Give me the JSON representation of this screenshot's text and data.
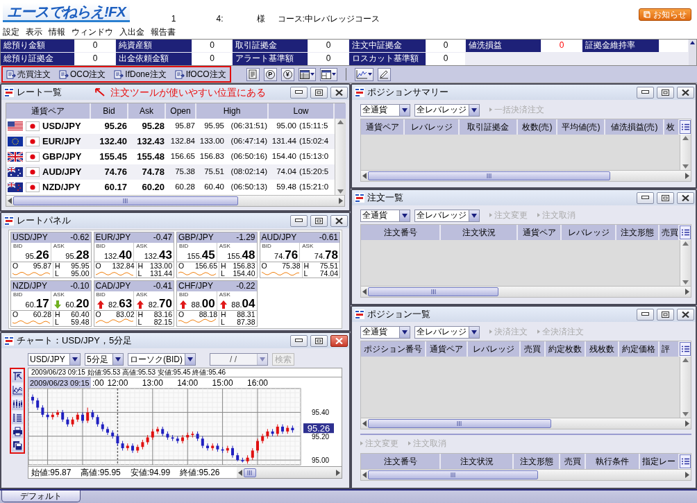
{
  "header": {
    "logo": "エースでねらえ!FX",
    "user_info": [
      "1",
      "4:",
      "様",
      "コース:中レバレッジコース"
    ],
    "notice_button": "お知らせ"
  },
  "menu": [
    "設定",
    "表示",
    "情報",
    "ウィンドウ",
    "入出金",
    "報告書"
  ],
  "account": [
    [
      {
        "label": "総預り金額",
        "value": "0",
        "alert": false
      },
      {
        "label": "純資産額",
        "value": "0",
        "alert": false
      },
      {
        "label": "取引証拠金",
        "value": "0",
        "alert": false
      },
      {
        "label": "注文中証拠金",
        "value": "0",
        "alert": false
      },
      {
        "label": "値洗損益",
        "value": "0",
        "alert": true
      },
      {
        "label": "証拠金維持率"
      }
    ],
    [
      {
        "label": "総預り証拠金",
        "value": "0",
        "alert": false
      },
      {
        "label": "出金依頼金額",
        "value": "0",
        "alert": false
      },
      {
        "label": "アラート基準額",
        "value": "0",
        "alert": false
      },
      {
        "label": "ロスカット基準額",
        "value": "0",
        "alert": false
      }
    ]
  ],
  "toolbar": {
    "order_buttons": [
      "売買注文",
      "OCO注文",
      "IfDone注文",
      "IfOCO注文"
    ],
    "tools": [
      {
        "kind": "document",
        "dropdown": false
      },
      {
        "kind": "coin",
        "glyph": "P",
        "dropdown": false
      },
      {
        "kind": "coin",
        "glyph": "¥",
        "dropdown": false
      },
      {
        "kind": "table",
        "dropdown": true
      },
      {
        "kind": "layout",
        "dropdown": true
      },
      {
        "kind": "separator",
        "dropdown": false
      },
      {
        "kind": "chart",
        "dropdown": true
      },
      {
        "kind": "pen",
        "dropdown": false
      }
    ]
  },
  "callout": "注文ツールが使いやすい位置にある",
  "rate_list": {
    "title": "レート一覧",
    "active": false,
    "columns": [
      "通貨ペア",
      "Bid",
      "Ask",
      "Open",
      "High",
      "Low"
    ],
    "rows": [
      {
        "kind": "us",
        "pair": "USD/JPY",
        "bid": "95.26",
        "ask": "95.28",
        "open": "95.87",
        "high": "95.95",
        "high_time": "(06:31:51)",
        "low": "95.00",
        "low_time": "(15:11:5"
      },
      {
        "kind": "eu",
        "pair": "EUR/JPY",
        "bid": "132.40",
        "ask": "132.43",
        "open": "132.84",
        "high": "133.00",
        "high_time": "(06:47:14)",
        "low": "131.44",
        "low_time": "(15:02:4"
      },
      {
        "kind": "gb",
        "pair": "GBP/JPY",
        "bid": "155.45",
        "ask": "155.48",
        "open": "156.65",
        "high": "156.83",
        "high_time": "(06:50:16)",
        "low": "154.40",
        "low_time": "(15:13:0"
      },
      {
        "kind": "au",
        "pair": "AUD/JPY",
        "bid": "74.76",
        "ask": "74.78",
        "open": "75.38",
        "high": "75.51",
        "high_time": "(08:02:14)",
        "low": "74.04",
        "low_time": "(15:20:5"
      },
      {
        "kind": "nz",
        "pair": "NZD/JPY",
        "bid": "60.17",
        "ask": "60.20",
        "open": "60.28",
        "high": "60.40",
        "high_time": "(06:50:13)",
        "low": "59.48",
        "low_time": "(15:21:0"
      }
    ]
  },
  "rate_panel": {
    "title": "レートパネル",
    "active": false,
    "tiles": [
      {
        "pair": "USD/JPY",
        "change": "-0.62",
        "bid_label": "BID",
        "bid_major": "95.",
        "bid_minor": "26",
        "bid_up": false,
        "bid_down": false,
        "ask_label": "ASK",
        "ask_major": "95.",
        "ask_minor": "28",
        "ask_up": false,
        "ask_down": false,
        "open_label": "O",
        "open": "95.87",
        "high_label": "H",
        "high": "95.95",
        "low_label": "L",
        "low": "95.00"
      },
      {
        "pair": "EUR/JPY",
        "change": "-0.47",
        "bid_label": "BID",
        "bid_major": "132.",
        "bid_minor": "40",
        "bid_up": false,
        "bid_down": false,
        "ask_label": "ASK",
        "ask_major": "132.",
        "ask_minor": "43",
        "ask_up": false,
        "ask_down": false,
        "open_label": "O",
        "open": "132.84",
        "high_label": "H",
        "high": "133.00",
        "low_label": "L",
        "low": "131.44"
      },
      {
        "pair": "GBP/JPY",
        "change": "-1.29",
        "bid_label": "BID",
        "bid_major": "155.",
        "bid_minor": "45",
        "bid_up": false,
        "bid_down": false,
        "ask_label": "ASK",
        "ask_major": "155.",
        "ask_minor": "48",
        "ask_up": false,
        "ask_down": false,
        "open_label": "O",
        "open": "156.65",
        "high_label": "H",
        "high": "156.83",
        "low_label": "L",
        "low": "154.40"
      },
      {
        "pair": "AUD/JPY",
        "change": "-0.61",
        "bid_label": "BID",
        "bid_major": "74.",
        "bid_minor": "76",
        "bid_up": false,
        "bid_down": false,
        "ask_label": "ASK",
        "ask_major": "74.",
        "ask_minor": "78",
        "ask_up": false,
        "ask_down": false,
        "open_label": "O",
        "open": "75.38",
        "high_label": "H",
        "high": "75.51",
        "low_label": "L",
        "low": "74.04"
      },
      {
        "pair": "NZD/JPY",
        "change": "-0.10",
        "bid_label": "BID",
        "bid_major": "60.",
        "bid_minor": "17",
        "bid_up": false,
        "bid_down": false,
        "ask_label": "ASK",
        "ask_major": "60.",
        "ask_minor": "20",
        "ask_up": false,
        "ask_down": true,
        "open_label": "O",
        "open": "60.28",
        "high_label": "H",
        "high": "60.40",
        "low_label": "L",
        "low": "59.48"
      },
      {
        "pair": "CAD/JPY",
        "change": "-0.41",
        "bid_label": "BID",
        "bid_major": "82.",
        "bid_minor": "63",
        "bid_up": true,
        "bid_down": false,
        "ask_label": "ASK",
        "ask_major": "82.",
        "ask_minor": "70",
        "ask_up": true,
        "ask_down": false,
        "open_label": "O",
        "open": "83.02",
        "high_label": "H",
        "high": "83.16",
        "low_label": "L",
        "low": "82.15"
      },
      {
        "pair": "CHF/JPY",
        "change": "-0.22",
        "bid_label": "BID",
        "bid_major": "88.",
        "bid_minor": "00",
        "bid_up": true,
        "bid_down": false,
        "ask_label": "ASK",
        "ask_major": "88.",
        "ask_minor": "04",
        "ask_up": true,
        "ask_down": false,
        "open_label": "O",
        "open": "88.18",
        "high_label": "H",
        "high": "88.31",
        "low_label": "L",
        "low": "87.38"
      }
    ]
  },
  "chart": {
    "title": "チャート：USD/JPY，5分足",
    "active": true,
    "selects": [
      "USD/JPY",
      "5分足",
      "ローソク(BID)"
    ],
    "date_field": {
      "value": "/   /",
      "disabled": true
    },
    "search_button": {
      "label": "検索",
      "disabled": true
    },
    "info_line": "2009/06/23 09:15  始値:95.53  高値:95.53  安値:95.45  終値:95.46",
    "cursor_label": "2009/06/23 09:15",
    "partial_tick_label": ":00",
    "current_price": "95.26",
    "chart_data": {
      "type": "candlestick",
      "categories": [
        null,
        null,
        null,
        null,
        null,
        null,
        null,
        null,
        null,
        null,
        null,
        null,
        null,
        null,
        null,
        null,
        null,
        "12:00",
        null,
        null,
        null,
        null,
        null,
        null,
        "13:00",
        null,
        null,
        null,
        null,
        null,
        null,
        "14:00",
        null,
        null,
        null,
        null,
        null,
        null,
        "15:00",
        null,
        null,
        null,
        null,
        null,
        null,
        "16:00",
        null,
        null,
        null,
        null,
        null,
        null,
        null
      ],
      "ohlc": [
        [
          95.53,
          95.55,
          95.47,
          95.5
        ],
        [
          95.5,
          95.52,
          95.42,
          95.44
        ],
        [
          95.44,
          95.46,
          95.36,
          95.38
        ],
        [
          95.38,
          95.4,
          95.34,
          95.36
        ],
        [
          95.36,
          95.4,
          95.34,
          95.38
        ],
        [
          95.38,
          95.42,
          95.36,
          95.4
        ],
        [
          95.4,
          95.42,
          95.32,
          95.34
        ],
        [
          95.34,
          95.36,
          95.28,
          95.3
        ],
        [
          95.3,
          95.36,
          95.28,
          95.34
        ],
        [
          95.34,
          95.4,
          95.32,
          95.38
        ],
        [
          95.38,
          95.4,
          95.31,
          95.33
        ],
        [
          95.33,
          95.44,
          95.31,
          95.4
        ],
        [
          95.4,
          95.42,
          95.34,
          95.36
        ],
        [
          95.36,
          95.38,
          95.28,
          95.3
        ],
        [
          95.3,
          95.32,
          95.24,
          95.26
        ],
        [
          95.26,
          95.28,
          95.21,
          95.23
        ],
        [
          95.23,
          95.25,
          95.18,
          95.2
        ],
        [
          95.2,
          95.22,
          95.12,
          95.14
        ],
        [
          95.14,
          95.16,
          95.08,
          95.1
        ],
        [
          95.1,
          95.14,
          95.08,
          95.12
        ],
        [
          95.12,
          95.14,
          95.06,
          95.08
        ],
        [
          95.08,
          95.13,
          95.06,
          95.11
        ],
        [
          95.11,
          95.17,
          95.09,
          95.15
        ],
        [
          95.15,
          95.21,
          95.13,
          95.19
        ],
        [
          95.19,
          95.26,
          95.17,
          95.24
        ],
        [
          95.24,
          95.28,
          95.22,
          95.26
        ],
        [
          95.26,
          95.28,
          95.2,
          95.22
        ],
        [
          95.22,
          95.24,
          95.17,
          95.19
        ],
        [
          95.19,
          95.21,
          95.16,
          95.18
        ],
        [
          95.18,
          95.2,
          95.14,
          95.16
        ],
        [
          95.16,
          95.21,
          95.14,
          95.19
        ],
        [
          95.19,
          95.23,
          95.17,
          95.21
        ],
        [
          95.21,
          95.24,
          95.19,
          95.22
        ],
        [
          95.22,
          95.24,
          95.16,
          95.18
        ],
        [
          95.18,
          95.2,
          95.1,
          95.12
        ],
        [
          95.12,
          95.14,
          95.08,
          95.1
        ],
        [
          95.1,
          95.14,
          95.08,
          95.12
        ],
        [
          95.12,
          95.14,
          95.07,
          95.09
        ],
        [
          95.09,
          95.11,
          95.06,
          95.08
        ],
        [
          95.08,
          95.12,
          95.06,
          95.1
        ],
        [
          95.1,
          95.12,
          95.02,
          95.04
        ],
        [
          95.04,
          95.06,
          94.99,
          95.0
        ],
        [
          95.0,
          95.02,
          94.98,
          94.99
        ],
        [
          94.99,
          95.04,
          94.97,
          95.02
        ],
        [
          95.02,
          95.1,
          95.0,
          95.08
        ],
        [
          95.08,
          95.18,
          95.06,
          95.16
        ],
        [
          95.16,
          95.22,
          95.14,
          95.2
        ],
        [
          95.2,
          95.26,
          95.18,
          95.24
        ],
        [
          95.24,
          95.26,
          95.2,
          95.22
        ],
        [
          95.22,
          95.3,
          95.2,
          95.28
        ],
        [
          95.28,
          95.3,
          95.22,
          95.24
        ],
        [
          95.24,
          95.29,
          95.22,
          95.27
        ],
        [
          95.27,
          95.29,
          95.23,
          95.25
        ]
      ],
      "ylim": [
        94.96,
        95.6
      ],
      "grid": true,
      "yticks": [
        {
          "value": 95.4,
          "label": "95.40"
        },
        {
          "value": 95.2,
          "label": "95.20"
        },
        {
          "value": 95.0,
          "label": "95.00"
        }
      ]
    },
    "summary": [
      "始値:95.87",
      "高値:95.95",
      "安値:94.99",
      "終値:95.26"
    ]
  },
  "position_summary": {
    "title": "ポジションサマリー",
    "active": false,
    "filters": [
      "全通貨",
      "全レバレッジ"
    ],
    "actions": [
      {
        "label": "一括決済注文",
        "disabled": true
      }
    ],
    "columns": [
      "通貨ペア",
      "レバレッジ",
      "取引証拠金",
      "枚数(売)",
      "平均値(売)",
      "値洗損益(売)",
      "枚"
    ]
  },
  "order_list": {
    "title": "注文一覧",
    "active": false,
    "filters": [
      "全通貨",
      "全レバレッジ"
    ],
    "actions": [
      {
        "label": "注文変更",
        "disabled": true
      },
      {
        "label": "注文取消",
        "disabled": true
      }
    ],
    "columns": [
      "注文番号",
      "注文状況",
      "通貨ペア",
      "レバレッジ",
      "注文形態",
      "売買"
    ]
  },
  "position_list": {
    "title": "ポジション一覧",
    "active": false,
    "filters": [
      "全通貨",
      "全レバレッジ"
    ],
    "actions": [
      {
        "label": "決済注文",
        "disabled": true
      },
      {
        "label": "全決済注文",
        "disabled": true
      }
    ],
    "columns": [
      "ポジション番号",
      "通貨ペア",
      "レバレッジ",
      "売買",
      "約定枚数",
      "残枚数",
      "約定価格",
      "評"
    ],
    "order_actions": [
      {
        "label": "注文変更",
        "disabled": true
      },
      {
        "label": "注文取消",
        "disabled": true
      }
    ],
    "order_columns": [
      "注文番号",
      "注文状況",
      "注文形態",
      "売買",
      "執行条件",
      "指定レー"
    ]
  },
  "bottom_tabs": [
    {
      "label": "デフォルト",
      "selected": true
    }
  ]
}
